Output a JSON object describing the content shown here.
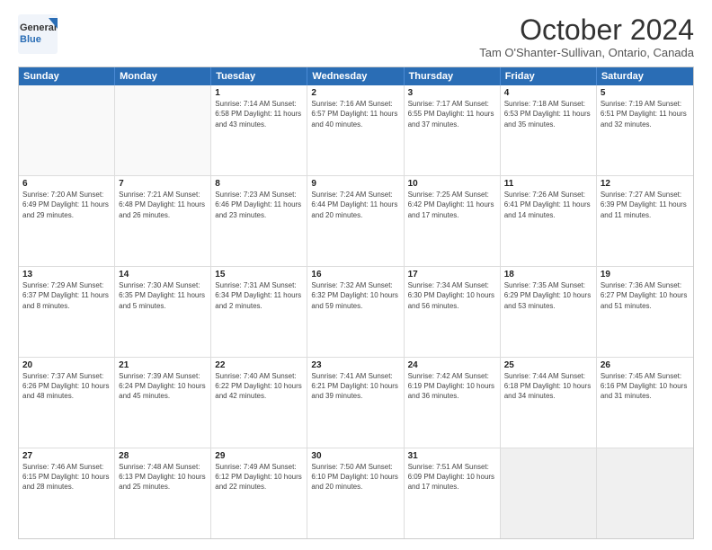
{
  "logo": {
    "general": "General",
    "blue": "Blue"
  },
  "header": {
    "month": "October 2024",
    "location": "Tam O'Shanter-Sullivan, Ontario, Canada"
  },
  "days": [
    "Sunday",
    "Monday",
    "Tuesday",
    "Wednesday",
    "Thursday",
    "Friday",
    "Saturday"
  ],
  "rows": [
    [
      {
        "day": "",
        "content": ""
      },
      {
        "day": "",
        "content": ""
      },
      {
        "day": "1",
        "content": "Sunrise: 7:14 AM\nSunset: 6:58 PM\nDaylight: 11 hours and 43 minutes."
      },
      {
        "day": "2",
        "content": "Sunrise: 7:16 AM\nSunset: 6:57 PM\nDaylight: 11 hours and 40 minutes."
      },
      {
        "day": "3",
        "content": "Sunrise: 7:17 AM\nSunset: 6:55 PM\nDaylight: 11 hours and 37 minutes."
      },
      {
        "day": "4",
        "content": "Sunrise: 7:18 AM\nSunset: 6:53 PM\nDaylight: 11 hours and 35 minutes."
      },
      {
        "day": "5",
        "content": "Sunrise: 7:19 AM\nSunset: 6:51 PM\nDaylight: 11 hours and 32 minutes."
      }
    ],
    [
      {
        "day": "6",
        "content": "Sunrise: 7:20 AM\nSunset: 6:49 PM\nDaylight: 11 hours and 29 minutes."
      },
      {
        "day": "7",
        "content": "Sunrise: 7:21 AM\nSunset: 6:48 PM\nDaylight: 11 hours and 26 minutes."
      },
      {
        "day": "8",
        "content": "Sunrise: 7:23 AM\nSunset: 6:46 PM\nDaylight: 11 hours and 23 minutes."
      },
      {
        "day": "9",
        "content": "Sunrise: 7:24 AM\nSunset: 6:44 PM\nDaylight: 11 hours and 20 minutes."
      },
      {
        "day": "10",
        "content": "Sunrise: 7:25 AM\nSunset: 6:42 PM\nDaylight: 11 hours and 17 minutes."
      },
      {
        "day": "11",
        "content": "Sunrise: 7:26 AM\nSunset: 6:41 PM\nDaylight: 11 hours and 14 minutes."
      },
      {
        "day": "12",
        "content": "Sunrise: 7:27 AM\nSunset: 6:39 PM\nDaylight: 11 hours and 11 minutes."
      }
    ],
    [
      {
        "day": "13",
        "content": "Sunrise: 7:29 AM\nSunset: 6:37 PM\nDaylight: 11 hours and 8 minutes."
      },
      {
        "day": "14",
        "content": "Sunrise: 7:30 AM\nSunset: 6:35 PM\nDaylight: 11 hours and 5 minutes."
      },
      {
        "day": "15",
        "content": "Sunrise: 7:31 AM\nSunset: 6:34 PM\nDaylight: 11 hours and 2 minutes."
      },
      {
        "day": "16",
        "content": "Sunrise: 7:32 AM\nSunset: 6:32 PM\nDaylight: 10 hours and 59 minutes."
      },
      {
        "day": "17",
        "content": "Sunrise: 7:34 AM\nSunset: 6:30 PM\nDaylight: 10 hours and 56 minutes."
      },
      {
        "day": "18",
        "content": "Sunrise: 7:35 AM\nSunset: 6:29 PM\nDaylight: 10 hours and 53 minutes."
      },
      {
        "day": "19",
        "content": "Sunrise: 7:36 AM\nSunset: 6:27 PM\nDaylight: 10 hours and 51 minutes."
      }
    ],
    [
      {
        "day": "20",
        "content": "Sunrise: 7:37 AM\nSunset: 6:26 PM\nDaylight: 10 hours and 48 minutes."
      },
      {
        "day": "21",
        "content": "Sunrise: 7:39 AM\nSunset: 6:24 PM\nDaylight: 10 hours and 45 minutes."
      },
      {
        "day": "22",
        "content": "Sunrise: 7:40 AM\nSunset: 6:22 PM\nDaylight: 10 hours and 42 minutes."
      },
      {
        "day": "23",
        "content": "Sunrise: 7:41 AM\nSunset: 6:21 PM\nDaylight: 10 hours and 39 minutes."
      },
      {
        "day": "24",
        "content": "Sunrise: 7:42 AM\nSunset: 6:19 PM\nDaylight: 10 hours and 36 minutes."
      },
      {
        "day": "25",
        "content": "Sunrise: 7:44 AM\nSunset: 6:18 PM\nDaylight: 10 hours and 34 minutes."
      },
      {
        "day": "26",
        "content": "Sunrise: 7:45 AM\nSunset: 6:16 PM\nDaylight: 10 hours and 31 minutes."
      }
    ],
    [
      {
        "day": "27",
        "content": "Sunrise: 7:46 AM\nSunset: 6:15 PM\nDaylight: 10 hours and 28 minutes."
      },
      {
        "day": "28",
        "content": "Sunrise: 7:48 AM\nSunset: 6:13 PM\nDaylight: 10 hours and 25 minutes."
      },
      {
        "day": "29",
        "content": "Sunrise: 7:49 AM\nSunset: 6:12 PM\nDaylight: 10 hours and 22 minutes."
      },
      {
        "day": "30",
        "content": "Sunrise: 7:50 AM\nSunset: 6:10 PM\nDaylight: 10 hours and 20 minutes."
      },
      {
        "day": "31",
        "content": "Sunrise: 7:51 AM\nSunset: 6:09 PM\nDaylight: 10 hours and 17 minutes."
      },
      {
        "day": "",
        "content": ""
      },
      {
        "day": "",
        "content": ""
      }
    ]
  ]
}
